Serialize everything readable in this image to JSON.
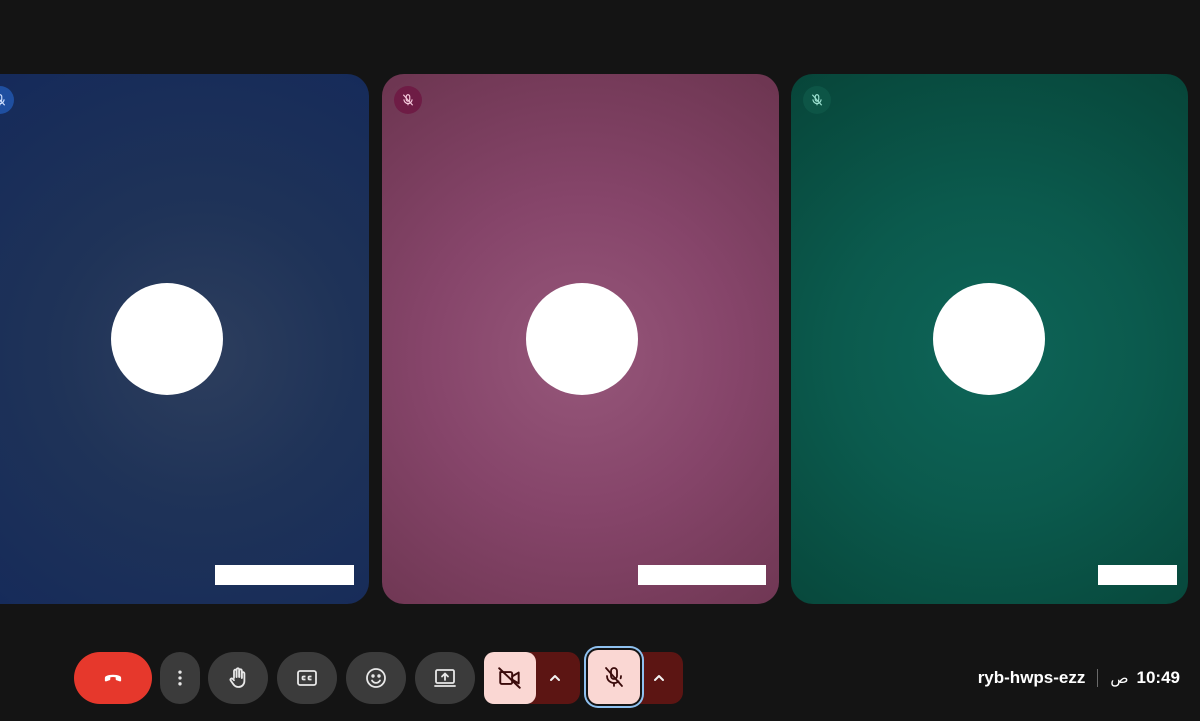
{
  "meeting": {
    "code": "ryb-hwps-ezz",
    "time": "10:49",
    "ampm": "ص"
  },
  "participants": [
    {
      "tile_color": "#1f3358",
      "muted": true
    },
    {
      "tile_color": "#86456a",
      "muted": true
    },
    {
      "tile_color": "#0b5a4d",
      "muted": true
    }
  ],
  "toolbar": {
    "buttons": [
      {
        "name": "end-call-button",
        "icon": "phone-hangup-icon",
        "color": "#e6382c"
      },
      {
        "name": "more-options-button",
        "icon": "more-vert-icon"
      },
      {
        "name": "raise-hand-button",
        "icon": "hand-icon"
      },
      {
        "name": "captions-button",
        "icon": "closed-captions-icon"
      },
      {
        "name": "reactions-button",
        "icon": "emoji-icon"
      },
      {
        "name": "present-button",
        "icon": "present-screen-icon"
      },
      {
        "name": "camera-off-button",
        "icon": "videocam-off-icon",
        "color": "#fad7d3"
      },
      {
        "name": "camera-options-button",
        "icon": "chevron-up-icon"
      },
      {
        "name": "mic-off-button",
        "icon": "mic-off-icon",
        "color": "#fad7d3"
      },
      {
        "name": "mic-options-button",
        "icon": "chevron-up-icon"
      }
    ]
  }
}
